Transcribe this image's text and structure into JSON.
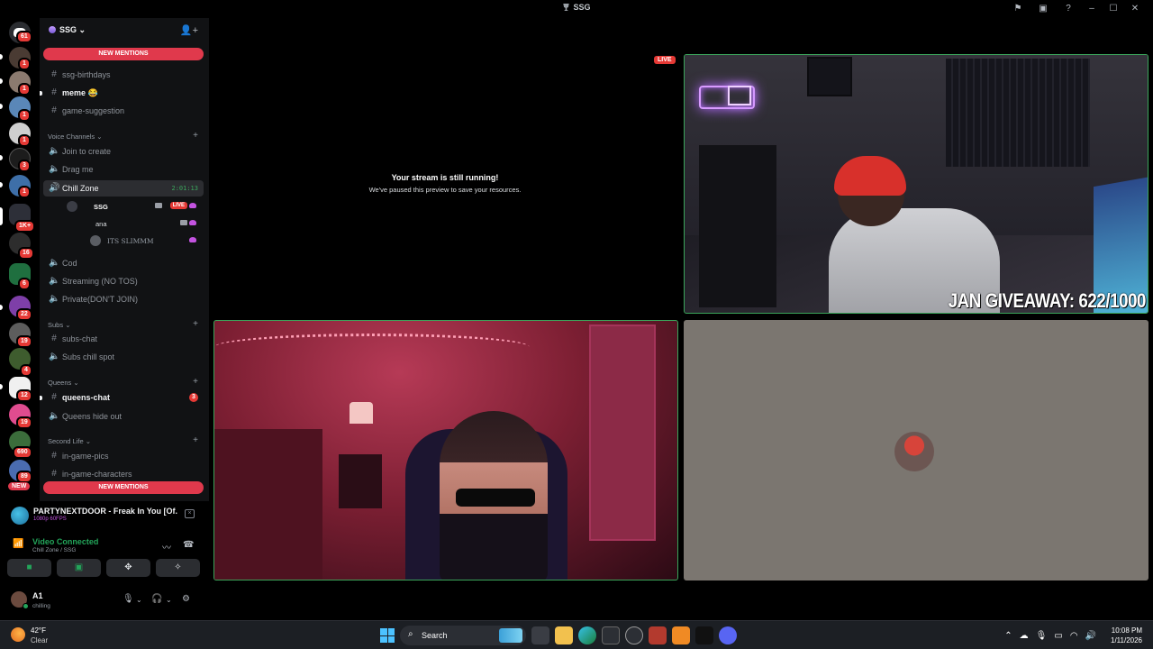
{
  "window": {
    "title": "SSG",
    "controls": [
      "flag-icon",
      "inbox-icon",
      "help-icon",
      "minimize",
      "maximize",
      "close"
    ]
  },
  "server_rail": {
    "servers": [
      {
        "badge": "61"
      },
      {
        "badge": "1"
      },
      {
        "badge": "1"
      },
      {
        "badge": "1"
      },
      {
        "badge": "1"
      },
      {
        "badge": "3"
      },
      {
        "badge": "1"
      },
      {
        "badge": ""
      },
      {
        "badge": "1K+"
      },
      {
        "badge": "16"
      },
      {
        "badge": "6"
      },
      {
        "badge": "22"
      },
      {
        "badge": "19"
      },
      {
        "badge": "4"
      },
      {
        "badge": "12"
      },
      {
        "badge": "19"
      },
      {
        "badge": "690"
      },
      {
        "badge": "89"
      }
    ],
    "new_label": "NEW"
  },
  "server": {
    "name": "SSG",
    "new_mentions": "NEW MENTIONS"
  },
  "channels": {
    "top": [
      {
        "name": "ssg-birthdays",
        "icon": "#",
        "unread": false
      },
      {
        "name": "meme 😂",
        "icon": "#",
        "unread": true
      },
      {
        "name": "game-suggestion",
        "icon": "#",
        "unread": false
      }
    ],
    "voice_category": "Voice Channels",
    "voice": [
      {
        "name": "Join to create"
      },
      {
        "name": "Drag me"
      }
    ],
    "active_voice": {
      "name": "Chill Zone",
      "time": "2:01:13"
    },
    "voice_users": [
      {
        "name": "SSG",
        "live": "LIVE"
      },
      {
        "name": "ana"
      },
      {
        "name": "ITS SLIMMM"
      }
    ],
    "more_voice": [
      {
        "name": "Cod"
      },
      {
        "name": "Streaming (NO TOS)"
      },
      {
        "name": "Private(DON'T JOIN)"
      }
    ],
    "subs_category": "Subs",
    "subs": [
      {
        "name": "subs-chat",
        "icon": "#"
      },
      {
        "name": "Subs chill spot",
        "icon": "speaker"
      }
    ],
    "queens_category": "Queens",
    "queens": [
      {
        "name": "queens-chat",
        "icon": "#",
        "count": "3"
      },
      {
        "name": "Queens hide out",
        "icon": "speaker"
      }
    ],
    "second_life_category": "Second Life",
    "second_life": [
      {
        "name": "in-game-pics",
        "icon": "#"
      },
      {
        "name": "in-game-characters",
        "icon": "#"
      }
    ]
  },
  "now_playing": {
    "title": "PARTYNEXTDOOR - Freak In You [Of...",
    "sub": "1080p 60FPS"
  },
  "voice_connection": {
    "status": "Video Connected",
    "location": "Chill Zone / SSG"
  },
  "user": {
    "name": "A1",
    "status": "chilling"
  },
  "stage": {
    "paused_title": "Your stream is still running!",
    "paused_sub": "We've paused this preview to save your resources.",
    "live_label": "LIVE",
    "overlay_text": "JAN GIVEAWAY: 622/1000"
  },
  "taskbar": {
    "temp": "42°F",
    "condition": "Clear",
    "search_placeholder": "Search",
    "time": "10:08 PM",
    "date": "1/11/2026",
    "accent": "#4cc2ff"
  },
  "colors": {
    "mentions": "#e0394c",
    "online": "#23a55a",
    "live": "#e53935"
  }
}
